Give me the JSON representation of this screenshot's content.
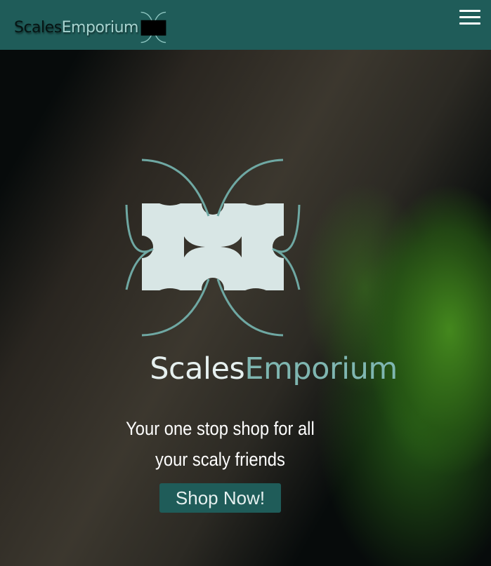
{
  "nav": {
    "brand_part1": "Scales",
    "brand_part2": "Emporium",
    "menu_icon": "hamburger-menu-icon"
  },
  "hero": {
    "title_part1": "Scales",
    "title_part2": "Emporium",
    "tagline_line1": "Your one stop shop for all",
    "tagline_line2": "your scaly friends",
    "cta_label": "Shop Now!"
  },
  "colors": {
    "brand_teal": "#1f5c59",
    "accent_light": "#a7d3cf",
    "logo_fill": "#d8e6e5"
  }
}
